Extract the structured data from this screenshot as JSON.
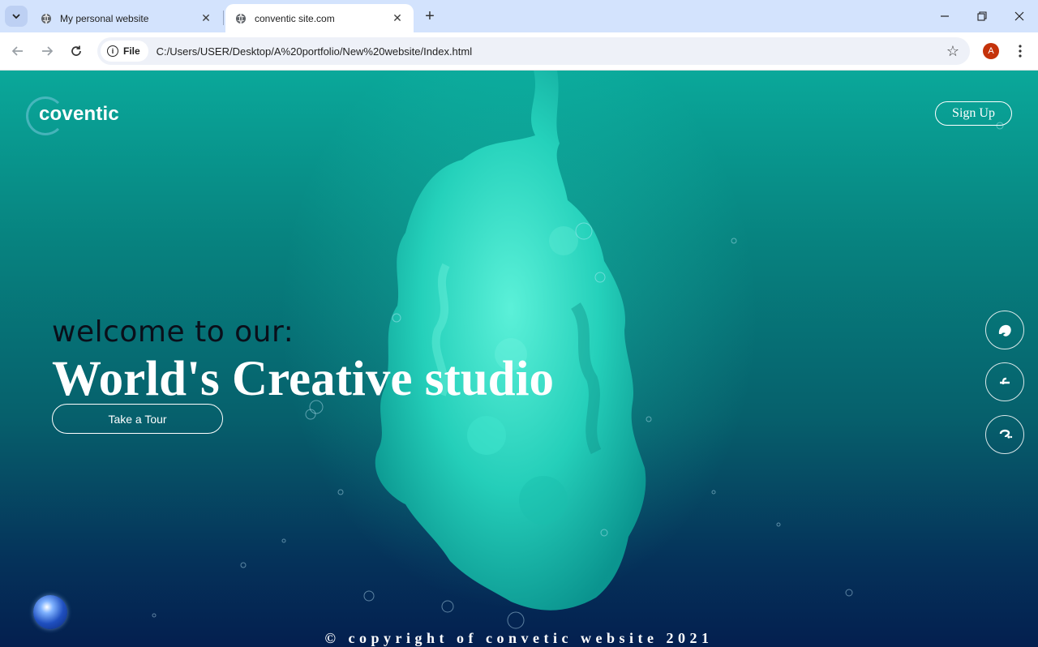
{
  "browser": {
    "tabs": [
      {
        "title": "My personal website",
        "active": false
      },
      {
        "title": "conventic site.com",
        "active": true
      }
    ],
    "address": {
      "chip_label": "File",
      "url": "C:/Users/USER/Desktop/A%20portfolio/New%20website/Index.html"
    },
    "profile_initial": "A",
    "icons": {
      "tab_search": "chevron-down-icon",
      "favicon": "globe-icon",
      "close": "close-icon",
      "new_tab": "plus-icon",
      "back": "arrow-left-icon",
      "forward": "arrow-right-icon",
      "reload": "reload-icon",
      "bookmark": "star-icon",
      "menu": "kebab-menu-icon",
      "minimize": "minimize-icon",
      "restore": "restore-icon",
      "window_close": "close-icon"
    },
    "colors": {
      "tabbar": "#d3e3fd",
      "avatar": "#c4320a"
    }
  },
  "site": {
    "logo": "coventic",
    "signup_label": "Sign Up",
    "welcome_text": "welcome to our:",
    "headline": "World's Creative studio",
    "tour_label": "Take a Tour",
    "social": [
      {
        "name": "social-icon-1",
        "glyph": "❧"
      },
      {
        "name": "facebook-icon",
        "glyph": "f"
      },
      {
        "name": "social-icon-3",
        "glyph": "?"
      }
    ],
    "copyright": "© copyright of convetic website 2021",
    "colors": {
      "accent": "#0aa89a",
      "deep": "#041f4f",
      "ink": "#2fe0c4"
    }
  }
}
